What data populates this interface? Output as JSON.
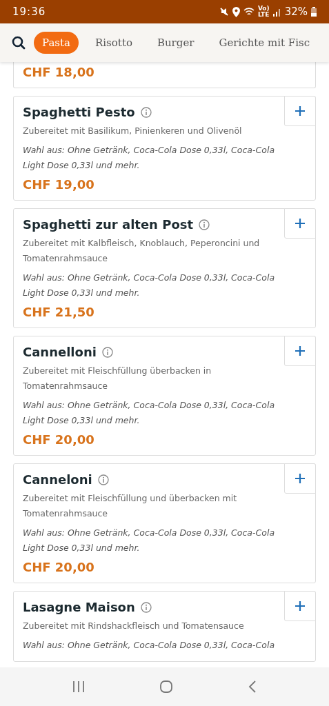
{
  "status_bar": {
    "time": "19:36",
    "network_label": [
      "Vo)",
      "LTE"
    ],
    "battery": "32%"
  },
  "tabs": [
    {
      "label": "Pasta",
      "selected": true
    },
    {
      "label": "Risotto",
      "selected": false
    },
    {
      "label": "Burger",
      "selected": false
    },
    {
      "label": "Gerichte mit Fisc",
      "selected": false
    }
  ],
  "items": [
    {
      "price": "CHF 18,00"
    },
    {
      "name": "Spaghetti Pesto",
      "description": "Zubereitet mit Basilikum, Pinienkeren und Olivenöl",
      "options": "Wahl aus: Ohne Getränk, Coca-Cola Dose 0,33l, Coca-Cola Light Dose 0,33l und mehr.",
      "price": "CHF 19,00"
    },
    {
      "name": "Spaghetti zur alten Post",
      "description": "Zubereitet mit Kalbfleisch, Knoblauch, Peperoncini und Tomatenrahmsauce",
      "options": "Wahl aus: Ohne Getränk, Coca-Cola Dose 0,33l, Coca-Cola Light Dose 0,33l und mehr.",
      "price": "CHF 21,50"
    },
    {
      "name": "Cannelloni",
      "description": "Zubereitet mit Fleischfüllung überbacken in Tomatenrahmsauce",
      "options": "Wahl aus: Ohne Getränk, Coca-Cola Dose 0,33l, Coca-Cola Light Dose 0,33l und mehr.",
      "price": "CHF 20,00"
    },
    {
      "name": "Canneloni",
      "description": "Zubereitet mit Fleischfüllung und überbacken mit Tomatenrahmsauce",
      "options": "Wahl aus: Ohne Getränk, Coca-Cola Dose 0,33l, Coca-Cola Light Dose 0,33l und mehr.",
      "price": "CHF 20,00"
    },
    {
      "name": "Lasagne Maison",
      "description": "Zubereitet mit Rindshackfleisch und Tomatensauce",
      "options": "Wahl aus: Ohne Getränk, Coca-Cola Dose 0,33l, Coca-Cola"
    }
  ]
}
